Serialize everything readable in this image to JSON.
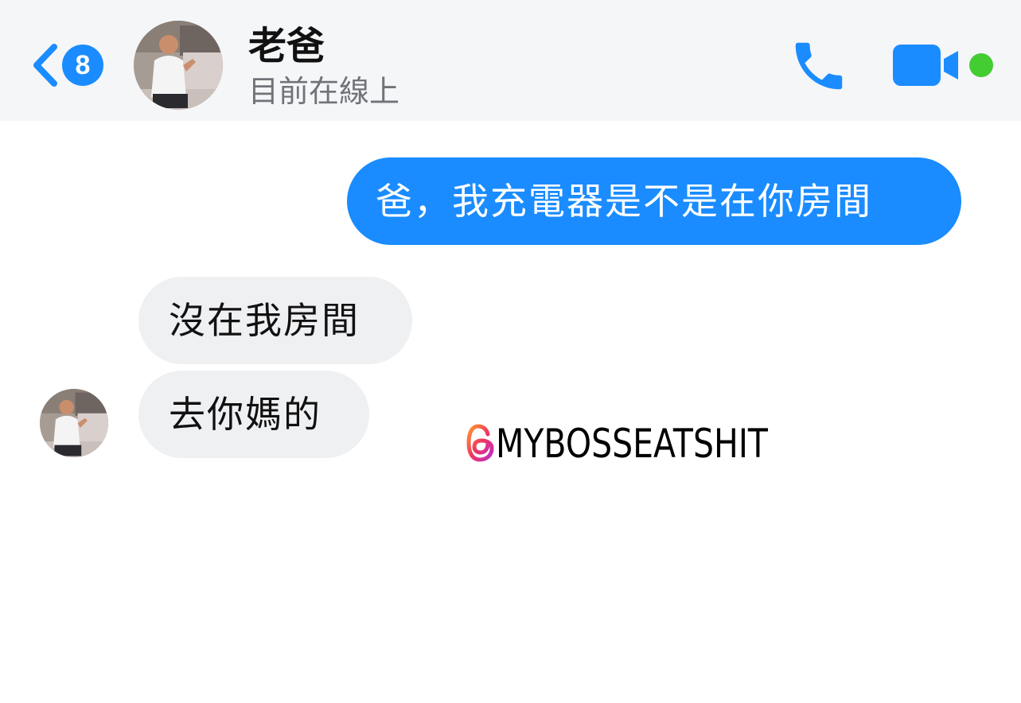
{
  "header": {
    "unread_count": "8",
    "contact_name": "老爸",
    "status": "目前在線上"
  },
  "messages": [
    {
      "direction": "outgoing",
      "text": "爸，我充電器是不是在你房間"
    },
    {
      "direction": "incoming",
      "text": "沒在我房間"
    },
    {
      "direction": "incoming",
      "text": "去你媽的"
    }
  ],
  "watermark": {
    "handle": "MYBOSSEATSHIT"
  },
  "icons": {
    "back": "chevron-left-icon",
    "call": "phone-icon",
    "video": "video-camera-icon",
    "online": "online-status-dot",
    "watermark_logo": "threads-logo-icon"
  },
  "colors": {
    "accent": "#1a8cff",
    "header_bg": "#f5f6f8",
    "incoming_bubble": "#eff0f2",
    "online": "#44cc33",
    "status_text": "#707479"
  }
}
